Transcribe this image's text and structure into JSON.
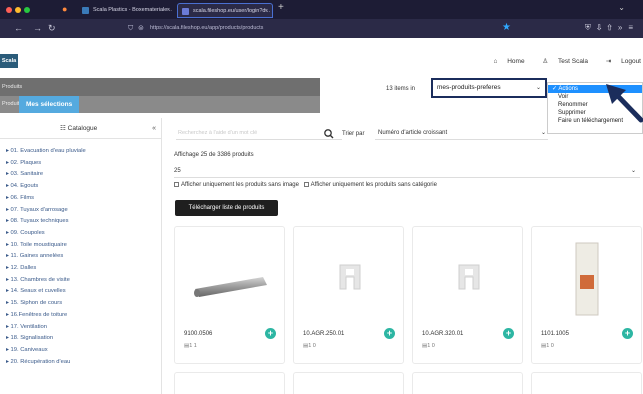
{
  "browser": {
    "tabs": [
      {
        "label": "Scala Plastics - Boxemateriale..."
      },
      {
        "label": "scala.fileshop.eu/user/login?d..."
      }
    ],
    "url": "https://scala.fileshop.eu/app/products/products"
  },
  "header": {
    "logo": "Scala",
    "links": [
      {
        "label": "Home",
        "icon": "home-icon"
      },
      {
        "label": "Test Scala",
        "icon": "user-icon"
      },
      {
        "label": "Logout",
        "icon": "logout-icon"
      }
    ]
  },
  "topnav": {
    "breadcrumb": "Produits",
    "small_label": "Produits",
    "selected_tab": "Mes sélections"
  },
  "list_toolbar": {
    "items_label": "13 items in",
    "selected_list": "mes-produits-preferes",
    "actions_menu": {
      "header": "Actions",
      "items": [
        "Voir",
        "Renommer",
        "Supprimer",
        "Faire un téléchargement"
      ]
    }
  },
  "sidebar": {
    "title": "Catalogue",
    "collapse": "«",
    "items": [
      "01. Evacuation d'eau pluviale",
      "02. Plaques",
      "03. Sanitaire",
      "04. Egouts",
      "06. Films",
      "07. Tuyaux d'arrosage",
      "08. Tuyaux techniques",
      "09. Coupoles",
      "10. Toile moustiquaire",
      "11. Gaines annelées",
      "12. Dalles",
      "13. Chambres de visite",
      "14. Seaux et cuvelles",
      "15. Siphon de cours",
      "16.Fenêtres de toiture",
      "17. Ventilation",
      "18. Signalisation",
      "19. Caniveaux",
      "20. Récupération d'eau"
    ]
  },
  "main": {
    "search_placeholder": "Recherchez à l'aide d'un mot clé",
    "sort_label": "Trier par",
    "sort_value": "Numéro d'article croissant",
    "display_text": "Affichage 25 de 3386 produits",
    "per_page": "25",
    "checkbox_no_image": "Afficher uniquement les produits sans image",
    "checkbox_no_category": "Afficher uniquement les produits sans catégorie",
    "download_button": "Télécharger liste de produits"
  },
  "products": [
    {
      "sku": "9100.0506",
      "meta": "1  1",
      "image": "tube"
    },
    {
      "sku": "10.AGR.250.01",
      "meta": "1  0",
      "image": "clip"
    },
    {
      "sku": "10.AGR.320.01",
      "meta": "1  0",
      "image": "clip"
    },
    {
      "sku": "1101.1005",
      "meta": "1  0",
      "image": "roll"
    }
  ],
  "colors": {
    "highlight_border": "#1b2d5c",
    "accent_blue": "#55aadf",
    "menu_selected": "#1e90ff",
    "add_button": "#2db6a3"
  }
}
